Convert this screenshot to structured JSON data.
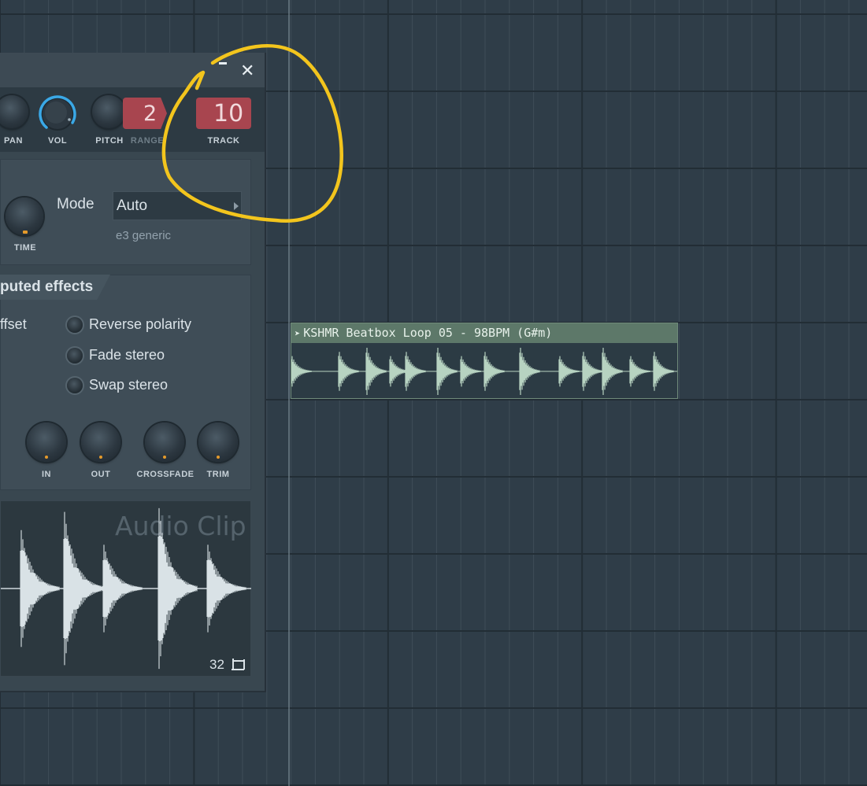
{
  "window": {
    "knobs": {
      "pan": "PAN",
      "vol": "VOL",
      "pitch": "PITCH",
      "range": "RANGE",
      "track": "TRACK"
    },
    "range_value": "2",
    "track_value": "10",
    "time_label": "TIME",
    "mode_label": "Mode",
    "mode_value": "Auto",
    "mode_sub": "e3 generic",
    "section_title": "puted effects",
    "offset_label": "ffset",
    "options": [
      "Reverse polarity",
      "Fade stereo",
      "Swap stereo"
    ],
    "bottom_knobs": [
      "IN",
      "OUT",
      "CROSSFADE",
      "TRIM"
    ],
    "preview_watermark": "Audio Clip",
    "preview_count": "32"
  },
  "clip": {
    "title": "KSHMR Beatbox Loop 05 - 98BPM (G#m)"
  },
  "colors": {
    "background": "#2f3d48",
    "grid_line": "#3f4d58",
    "clip_header": "#5d7869",
    "clip_wave": "#b7d3c1",
    "lcd": "#a8454f",
    "vol_ring": "#3aa8e6",
    "annotation": "#f3c51d"
  }
}
